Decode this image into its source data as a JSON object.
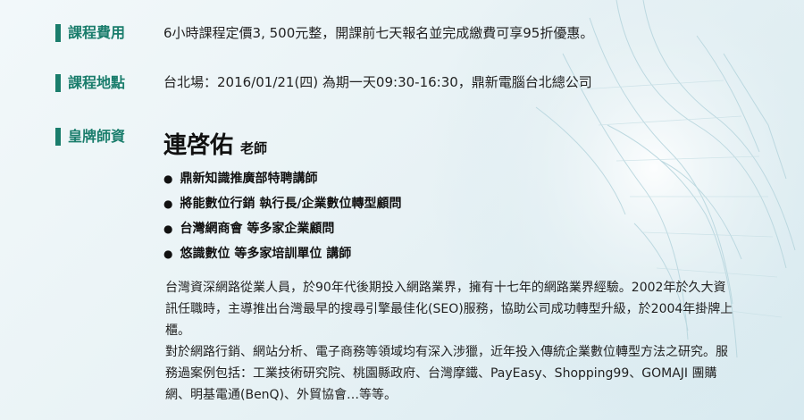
{
  "fee": {
    "label": "課程費用",
    "text": "6小時課程定價3, 500元整，開課前七天報名並完成繳費可享95折優惠。"
  },
  "location": {
    "label": "課程地點",
    "text": "台北場：2016/01/21(四) 為期一天09:30-16:30，鼎新電腦台北總公司"
  },
  "teacher": {
    "label": "皇牌師資",
    "name": "連啓佑",
    "title": "老師",
    "roles": [
      "鼎新知識推廣部特聘講師",
      "將能數位行銷 執行長/企業數位轉型顧問",
      "台灣網商會 等多家企業顧問",
      "悠識數位 等多家培訓單位 講師"
    ],
    "bio": [
      "台灣資深網路從業人員，於90年代後期投入網路業界，擁有十七年的網路業界經驗。2002年於久大資訊任職時，主導推出台灣最早的搜尋引擎最佳化(SEO)服務，協助公司成功轉型升級，於2004年掛牌上櫃。",
      "對於網路行銷、網站分析、電子商務等領域均有深入涉獵，近年投入傳統企業數位轉型方法之研究。服務過案例包括：工業技術研究院、桃園縣政府、台灣摩鐵、PayEasy、Shopping99、GOMAJI 團購網、明基電通(BenQ)、外貿協會…等等。"
    ]
  }
}
